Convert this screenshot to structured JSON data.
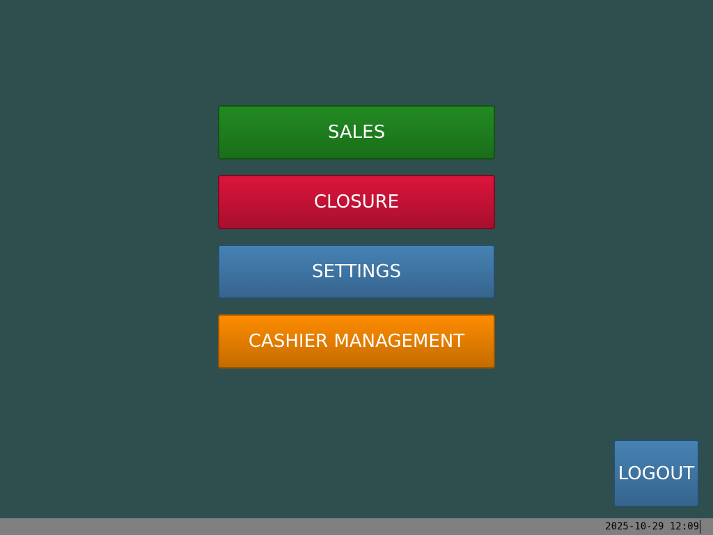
{
  "main_menu": {
    "sales_label": "SALES",
    "closure_label": "CLOSURE",
    "settings_label": "SETTINGS",
    "cashier_management_label": "CASHIER MANAGEMENT"
  },
  "logout_label": "LOGOUT",
  "status_bar": {
    "datetime": "2025-10-29 12:09"
  },
  "colors": {
    "background": "#2f4f4f",
    "sales": "#228b22",
    "closure": "#dc143c",
    "settings": "#4682b4",
    "cashier_management": "#ff8c00",
    "logout": "#4682b4",
    "status_bar": "#808080"
  }
}
